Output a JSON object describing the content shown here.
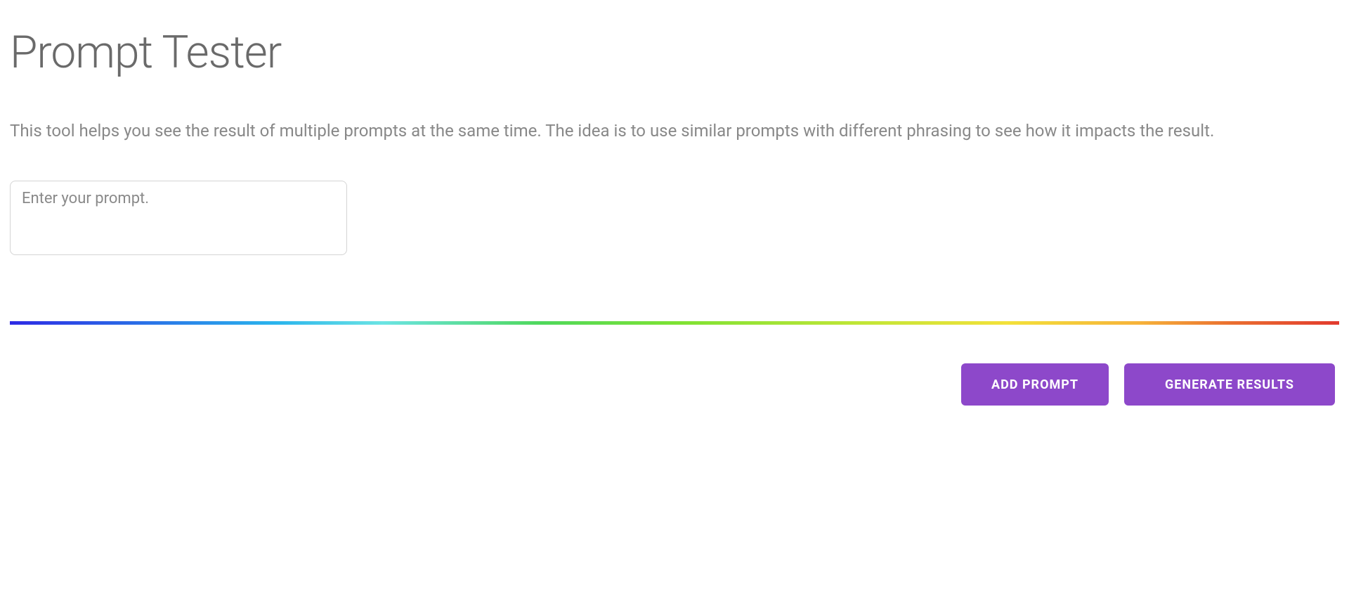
{
  "page": {
    "title": "Prompt Tester",
    "description": "This tool helps you see the result of multiple prompts at the same time. The idea is to use similar prompts with different phrasing to see how it impacts the result."
  },
  "prompt": {
    "placeholder": "Enter your prompt.",
    "value": ""
  },
  "buttons": {
    "add_prompt": "ADD PROMPT",
    "generate_results": "GENERATE RESULTS"
  },
  "colors": {
    "accent": "#8d48ca",
    "text_primary": "#6a6a6a",
    "text_secondary": "#888888",
    "border": "#d4d4d4"
  }
}
